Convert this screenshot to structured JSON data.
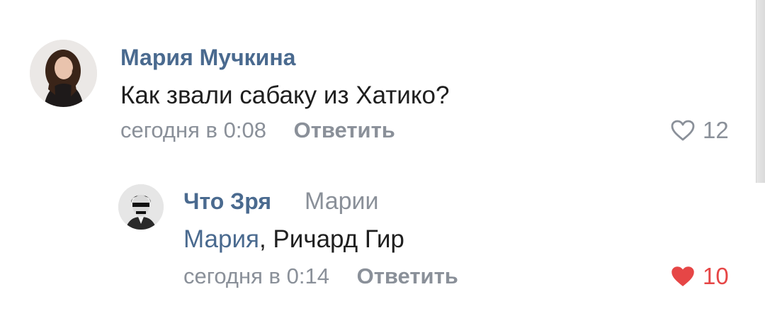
{
  "comments": [
    {
      "author": "Мария Мучкина",
      "text": "Как звали сабаку из Хатико?",
      "time": "сегодня в 0:08",
      "reply_label": "Ответить",
      "likes": "12",
      "liked": false
    },
    {
      "author": "Что Зря",
      "reply_to": "Марии",
      "mention": "Мария",
      "text_rest": ", Ричард Гир",
      "time": "сегодня в 0:14",
      "reply_label": "Ответить",
      "likes": "10",
      "liked": true
    }
  ],
  "colors": {
    "author": "#4a6a8f",
    "text": "#1f1f1f",
    "meta": "#8a9099",
    "like_active": "#e64646"
  },
  "icons": {
    "like_inactive": "heart-outline-icon",
    "like_active": "heart-filled-icon"
  }
}
